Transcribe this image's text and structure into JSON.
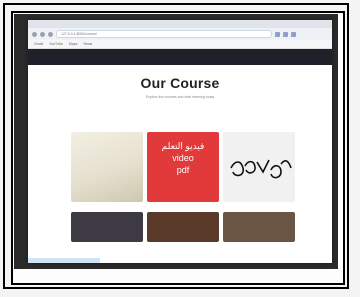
{
  "browser": {
    "url": "127.0.0.1:8000/course/",
    "bookmarks": [
      "Gmail",
      "YouTube",
      "Maps",
      "News"
    ]
  },
  "section": {
    "title": "Our Course",
    "description": "Explore the courses and start learning today"
  },
  "cards": [
    {
      "name": "fabric-lace"
    },
    {
      "name": "arabic-lessons",
      "lines": [
        "فيديو التعلم",
        "video",
        "pdf"
      ]
    },
    {
      "name": "handwriting-sketch"
    }
  ],
  "colors": {
    "accent_red": "#e23a3a",
    "hero_dark": "#1e2129"
  }
}
